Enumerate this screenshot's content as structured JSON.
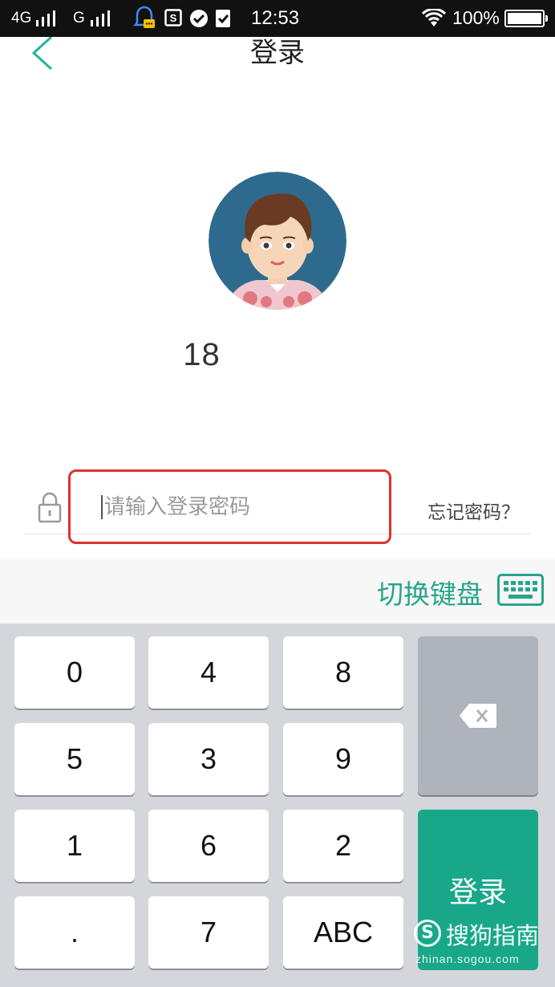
{
  "status_bar": {
    "network1": "4G",
    "network2": "G",
    "time": "12:53",
    "battery_pct": "100%"
  },
  "header": {
    "title": "登录",
    "back_icon": "chevron-left-icon"
  },
  "profile": {
    "phone_visible": "18"
  },
  "password": {
    "placeholder": "请输入登录密码",
    "forgot_label": "忘记密码？"
  },
  "keyboard_bar": {
    "switch_label": "切换键盘"
  },
  "keypad": {
    "keys": [
      "0",
      "4",
      "8",
      "5",
      "3",
      "9",
      "1",
      "6",
      "2",
      ".",
      "7",
      "ABC"
    ],
    "login_label": "登录"
  },
  "watermark": {
    "logo_glyph": "S",
    "name": "搜狗指南",
    "url": "zhinan.sogou.com"
  },
  "colors": {
    "accent": "#18a889",
    "highlight": "#e03030",
    "delete_key": "#aeb3bc"
  }
}
